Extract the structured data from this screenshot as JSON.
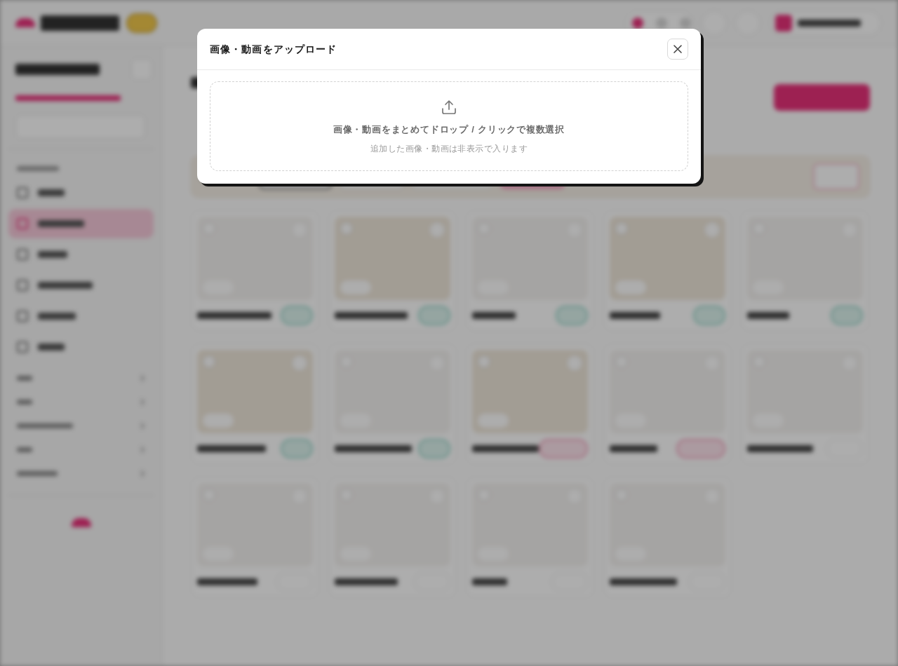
{
  "dialog": {
    "title": "画像・動画をアップロード"
  },
  "dropzone": {
    "instruction": "画像・動画をまとめてドロップ / クリックで複数選択",
    "note": "追加した画像・動画は非表示で入ります"
  }
}
